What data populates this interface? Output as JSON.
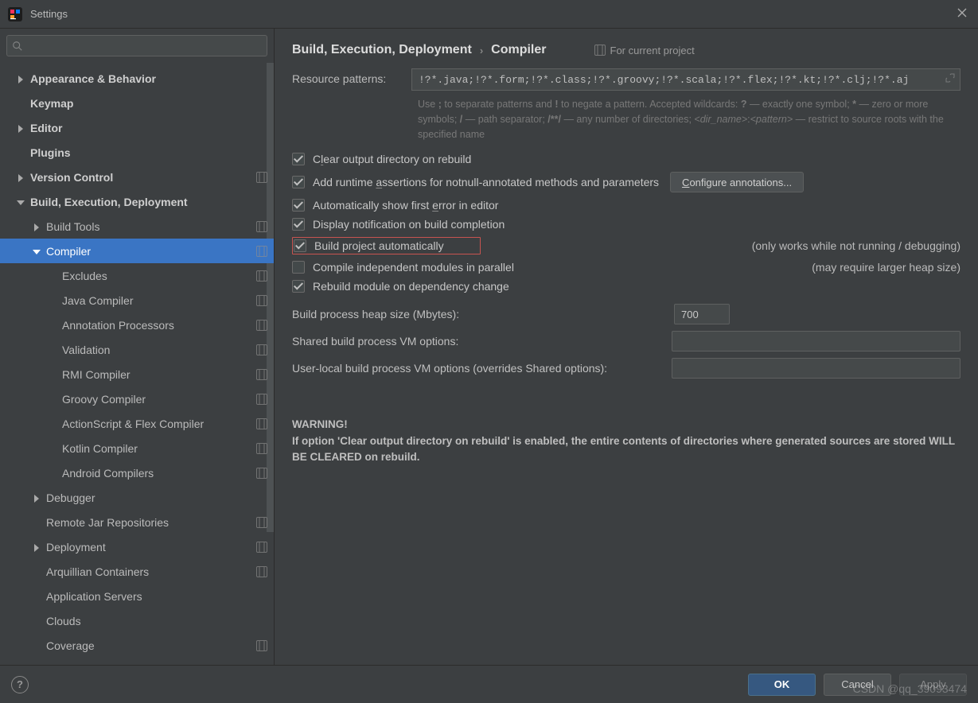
{
  "window": {
    "title": "Settings"
  },
  "search": {
    "placeholder": ""
  },
  "sidebar": {
    "items": [
      {
        "label": "Appearance & Behavior",
        "indent": 0,
        "arrow": "right",
        "bold": true,
        "proj": false
      },
      {
        "label": "Keymap",
        "indent": 0,
        "arrow": "none",
        "bold": true,
        "proj": false
      },
      {
        "label": "Editor",
        "indent": 0,
        "arrow": "right",
        "bold": true,
        "proj": false
      },
      {
        "label": "Plugins",
        "indent": 0,
        "arrow": "none",
        "bold": true,
        "proj": false
      },
      {
        "label": "Version Control",
        "indent": 0,
        "arrow": "right",
        "bold": true,
        "proj": true
      },
      {
        "label": "Build, Execution, Deployment",
        "indent": 0,
        "arrow": "down",
        "bold": true,
        "proj": false
      },
      {
        "label": "Build Tools",
        "indent": 1,
        "arrow": "right",
        "bold": false,
        "proj": true
      },
      {
        "label": "Compiler",
        "indent": 1,
        "arrow": "down",
        "bold": false,
        "proj": true,
        "selected": true
      },
      {
        "label": "Excludes",
        "indent": 2,
        "arrow": "none",
        "bold": false,
        "proj": true
      },
      {
        "label": "Java Compiler",
        "indent": 2,
        "arrow": "none",
        "bold": false,
        "proj": true
      },
      {
        "label": "Annotation Processors",
        "indent": 2,
        "arrow": "none",
        "bold": false,
        "proj": true
      },
      {
        "label": "Validation",
        "indent": 2,
        "arrow": "none",
        "bold": false,
        "proj": true
      },
      {
        "label": "RMI Compiler",
        "indent": 2,
        "arrow": "none",
        "bold": false,
        "proj": true
      },
      {
        "label": "Groovy Compiler",
        "indent": 2,
        "arrow": "none",
        "bold": false,
        "proj": true
      },
      {
        "label": "ActionScript & Flex Compiler",
        "indent": 2,
        "arrow": "none",
        "bold": false,
        "proj": true
      },
      {
        "label": "Kotlin Compiler",
        "indent": 2,
        "arrow": "none",
        "bold": false,
        "proj": true
      },
      {
        "label": "Android Compilers",
        "indent": 2,
        "arrow": "none",
        "bold": false,
        "proj": true
      },
      {
        "label": "Debugger",
        "indent": 1,
        "arrow": "right",
        "bold": false,
        "proj": false
      },
      {
        "label": "Remote Jar Repositories",
        "indent": 1,
        "arrow": "none",
        "bold": false,
        "proj": true
      },
      {
        "label": "Deployment",
        "indent": 1,
        "arrow": "right",
        "bold": false,
        "proj": true
      },
      {
        "label": "Arquillian Containers",
        "indent": 1,
        "arrow": "none",
        "bold": false,
        "proj": true
      },
      {
        "label": "Application Servers",
        "indent": 1,
        "arrow": "none",
        "bold": false,
        "proj": false
      },
      {
        "label": "Clouds",
        "indent": 1,
        "arrow": "none",
        "bold": false,
        "proj": false
      },
      {
        "label": "Coverage",
        "indent": 1,
        "arrow": "none",
        "bold": false,
        "proj": true
      }
    ]
  },
  "breadcrumb": {
    "a": "Build, Execution, Deployment",
    "b": "Compiler",
    "badge": "For current project"
  },
  "patterns": {
    "label": "Resource patterns:",
    "value": "!?*.java;!?*.form;!?*.class;!?*.groovy;!?*.scala;!?*.flex;!?*.kt;!?*.clj;!?*.aj"
  },
  "help": {
    "l1a": "Use ",
    "l1b": ";",
    "l1c": " to separate patterns and ",
    "l1d": "!",
    "l1e": " to negate a pattern. Accepted wildcards: ",
    "l1f": "?",
    "l1g": " — exactly one symbol; ",
    "l1h": "*",
    "l1i": " — zero or more symbols; ",
    "l1j": "/",
    "l1k": " — path separator; ",
    "l1l": "/**/",
    "l1m": " — any number of directories; ",
    "l1n": "<dir_name>",
    "l1o": ":",
    "l1p": "<pattern>",
    "l1q": " — restrict to source roots with the specified name"
  },
  "checks": {
    "clear": "Clear output directory on rebuild",
    "assert": "Add runtime assertions for notnull-annotated methods and parameters",
    "configure": "Configure annotations...",
    "autoerr": "Automatically show first error in editor",
    "displaynotif": "Display notification on build completion",
    "buildauto": "Build project automatically",
    "buildauto_aside": "(only works while not running / debugging)",
    "parallel": "Compile independent modules in parallel",
    "parallel_aside": "(may require larger heap size)",
    "rebuild": "Rebuild module on dependency change"
  },
  "fields": {
    "heap_label": "Build process heap size (Mbytes):",
    "heap_value": "700",
    "shared_label": "Shared build process VM options:",
    "shared_value": "",
    "user_label": "User-local build process VM options (overrides Shared options):",
    "user_value": ""
  },
  "warning": {
    "title": "WARNING!",
    "body": "If option 'Clear output directory on rebuild' is enabled, the entire contents of directories where generated sources are stored WILL BE CLEARED on rebuild."
  },
  "footer": {
    "ok": "OK",
    "cancel": "Cancel",
    "apply": "Apply"
  },
  "watermark": "CSDN @qq_39093474"
}
